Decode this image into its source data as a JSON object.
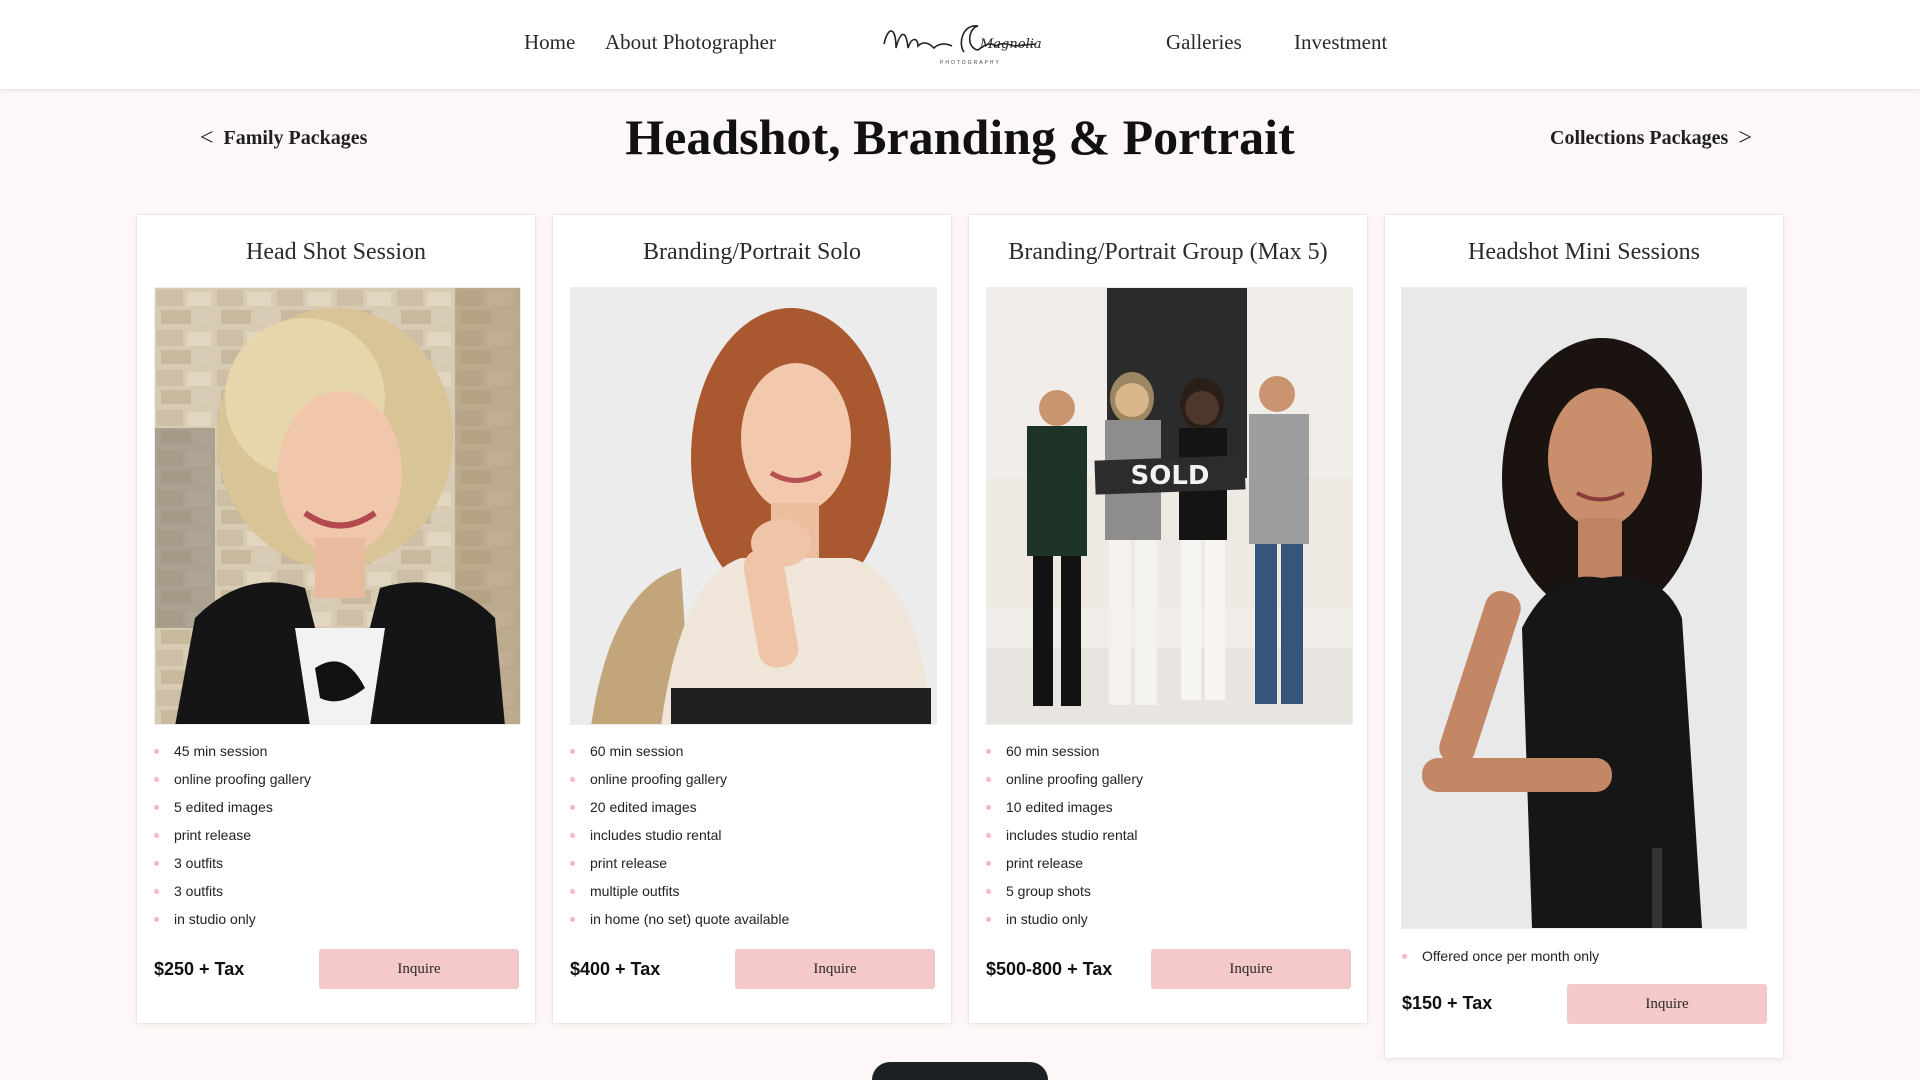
{
  "nav": {
    "home": "Home",
    "about": "About Photographer",
    "galleries": "Galleries",
    "investment": "Investment",
    "logo_text": "Magnolia Coasts",
    "logo_sub": "PHOTOGRAPHY"
  },
  "subnav": {
    "prev_label": "Family Packages",
    "prev_arrow": "<",
    "next_label": "Collections Packages",
    "next_arrow": ">"
  },
  "page_title": "Headshot, Branding & Portrait",
  "cards": [
    {
      "title": "Head Shot Session",
      "features": [
        "45 min session",
        "online proofing gallery",
        "5 edited images",
        "print release",
        "3 outfits",
        "3 outfits",
        "in studio only"
      ],
      "price": "$250 + Tax",
      "button": "Inquire"
    },
    {
      "title": "Branding/Portrait Solo",
      "features": [
        "60 min session",
        "online proofing gallery",
        "20 edited images",
        "includes studio rental",
        "print release",
        "multiple outfits",
        "in home (no set) quote available"
      ],
      "price": "$400 + Tax",
      "button": "Inquire"
    },
    {
      "title": "Branding/Portrait Group (Max 5)",
      "features": [
        "60 min session",
        "online proofing gallery",
        "10 edited images",
        "includes studio rental",
        "print release",
        "5 group shots",
        "in studio only"
      ],
      "price": "$500-800 + Tax",
      "button": "Inquire",
      "photo_sign": "SOLD"
    },
    {
      "title": "Headshot Mini Sessions",
      "features": [
        "Offered once per month only"
      ],
      "price": "$150 + Tax",
      "button": "Inquire"
    }
  ],
  "colors": {
    "accent": "#f5c8ca",
    "bullet": "#f2bcc0",
    "page_bg": "#fdf8f7"
  }
}
